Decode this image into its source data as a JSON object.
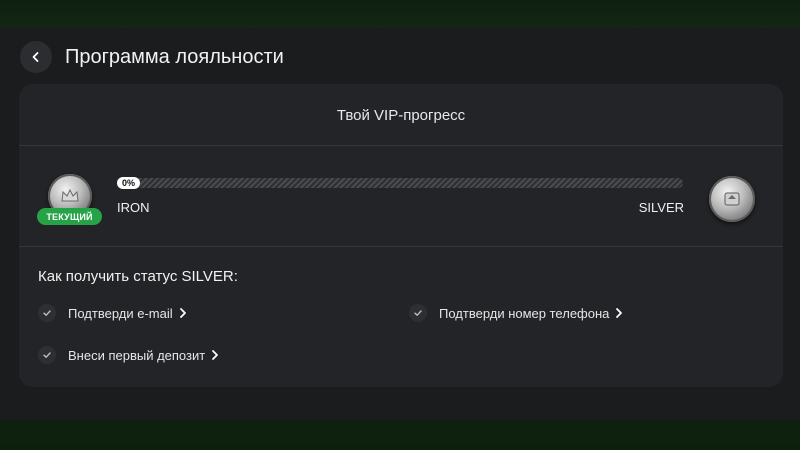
{
  "header": {
    "title": "Программа лояльности"
  },
  "card": {
    "title": "Твой VIP-прогресс",
    "progress": {
      "percent": 0,
      "percent_label": "0%",
      "current_badge": "ТЕКУЩИЙ",
      "current_level": "IRON",
      "next_level": "SILVER"
    },
    "requirements": {
      "title": "Как получить статус SILVER:",
      "items": [
        {
          "label": "Подтверди e-mail"
        },
        {
          "label": "Подтверди номер телефона"
        },
        {
          "label": "Внеси первый депозит"
        }
      ]
    }
  },
  "colors": {
    "background": "#1b1c1e",
    "card": "#232427",
    "accent_green": "#27a347"
  },
  "icons": [
    "chevron-left-icon",
    "check-icon",
    "chevron-right-icon",
    "iron-coin-icon",
    "silver-coin-icon"
  ]
}
